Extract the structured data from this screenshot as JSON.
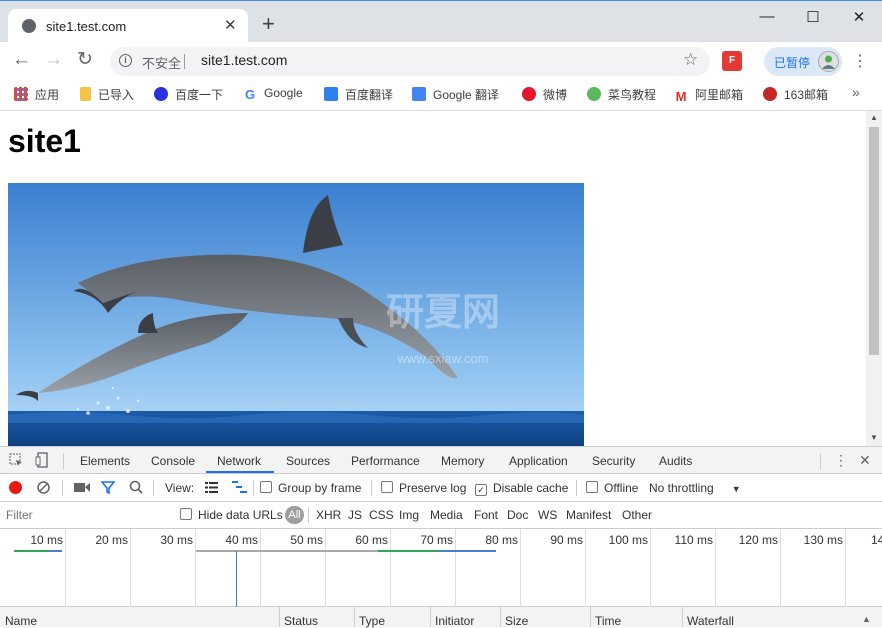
{
  "window": {
    "tab_title": "site1.test.com",
    "tab_close": "✕",
    "new_tab": "+",
    "minimize": "—",
    "maximize": "☐",
    "close": "✕"
  },
  "toolbar": {
    "back": "←",
    "forward": "→",
    "reload": "↻",
    "info_icon": "i",
    "security_label": "不安全",
    "url": "site1.test.com",
    "star": "☆",
    "extension_label": "F",
    "profile_label": "已暂停",
    "menu": "⋮"
  },
  "bookmarks": {
    "items": [
      {
        "label": "应用",
        "icon": "apps-grid-icon",
        "color": "#e8453c"
      },
      {
        "label": "已导入",
        "icon": "folder-icon",
        "color": "#f6c344"
      },
      {
        "label": "百度一下",
        "icon": "baidu-paw-icon",
        "color": "#2932e1"
      },
      {
        "label": "Google",
        "icon": "google-g-icon",
        "color": "#4285f4"
      },
      {
        "label": "百度翻译",
        "icon": "baidu-translate-icon",
        "color": "#2f80ed"
      },
      {
        "label": "Google 翻译",
        "icon": "google-translate-icon",
        "color": "#4285f4"
      },
      {
        "label": "微博",
        "icon": "weibo-icon",
        "color": "#e6162d"
      },
      {
        "label": "菜鸟教程",
        "icon": "runoob-icon",
        "color": "#5cb85c"
      },
      {
        "label": "阿里邮箱",
        "icon": "aliyun-mail-icon",
        "color": "#d93025"
      },
      {
        "label": "163邮箱",
        "icon": "163-mail-icon",
        "color": "#c62828"
      }
    ],
    "more": "»"
  },
  "page": {
    "heading": "site1",
    "watermark_main": "研夏网",
    "watermark_sub": "www.sxiaw.com"
  },
  "devtools": {
    "tabs": [
      "Elements",
      "Console",
      "Network",
      "Sources",
      "Performance",
      "Memory",
      "Application",
      "Security",
      "Audits"
    ],
    "active_tab": "Network",
    "toolbar": {
      "view_label": "View:",
      "group_by_frame": "Group by frame",
      "preserve_log": "Preserve log",
      "disable_cache": "Disable cache",
      "offline": "Offline",
      "throttling": "No throttling",
      "disable_cache_checked": true
    },
    "filter": {
      "placeholder": "Filter",
      "hide_data_urls": "Hide data URLs",
      "types": [
        "All",
        "XHR",
        "JS",
        "CSS",
        "Img",
        "Media",
        "Font",
        "Doc",
        "WS",
        "Manifest",
        "Other"
      ]
    },
    "timeline_ticks": [
      "10 ms",
      "20 ms",
      "30 ms",
      "40 ms",
      "50 ms",
      "60 ms",
      "70 ms",
      "80 ms",
      "90 ms",
      "100 ms",
      "110 ms",
      "120 ms",
      "130 ms",
      "14"
    ],
    "columns": [
      "Name",
      "Status",
      "Type",
      "Initiator",
      "Size",
      "Time",
      "Waterfall"
    ]
  },
  "colors": {
    "accent": "#1a73e8",
    "record": "#e8190e"
  }
}
